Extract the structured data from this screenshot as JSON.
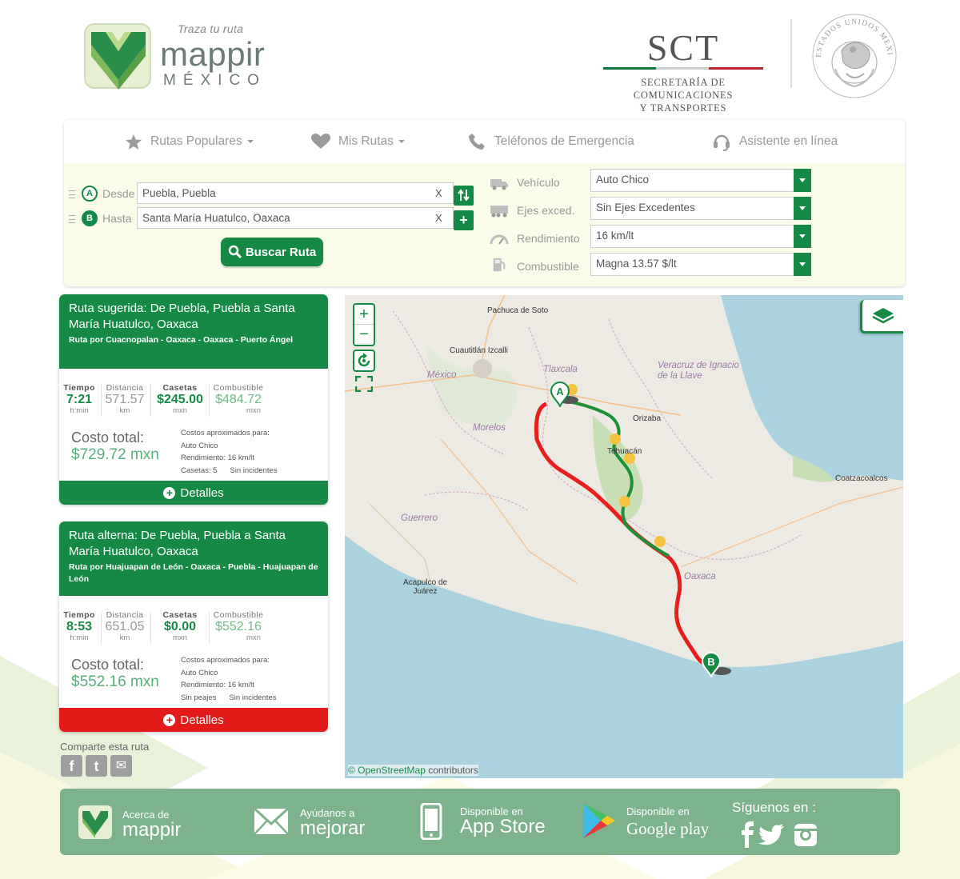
{
  "header": {
    "logo_tag": "Traza tu ruta",
    "logo_word": "mappir",
    "logo_country": "MÉXICO",
    "sct_title": "SCT",
    "sct_line1": "SECRETARÍA DE",
    "sct_line2": "COMUNICACIONES",
    "sct_line3": "Y TRANSPORTES",
    "seal_text": "ESTADOS UNIDOS MEXICANOS"
  },
  "nav": {
    "populares": "Rutas Populares",
    "mis_rutas": "Mis Rutas",
    "telefonos": "Teléfonos de Emergencia",
    "asistente": "Asistente en línea"
  },
  "search": {
    "from_pin": "A",
    "to_pin": "B",
    "from_label": "Desde",
    "to_label": "Hasta",
    "from_value": "Puebla, Puebla",
    "to_value": "Santa María Huatulco, Oaxaca",
    "clear": "X",
    "button": "Buscar Ruta"
  },
  "options": {
    "vehiculo_label": "Vehículo",
    "vehiculo_value": "Auto Chico",
    "ejes_label": "Ejes exced.",
    "ejes_value": "Sin Ejes Excedentes",
    "rendimiento_label": "Rendimiento",
    "rendimiento_value": "16 km/lt",
    "combustible_label": "Combustible",
    "combustible_value": "Magna 13.57 $/lt"
  },
  "labels": {
    "tiempo": "Tiempo",
    "distancia": "Distancia",
    "casetas": "Casetas",
    "combustible": "Combustible",
    "hmin": "h:min",
    "km": "km",
    "mxn": "mxn",
    "costo_total": "Costo total:",
    "costos_para": "Costos aproximados para:",
    "detalles": "Detalles"
  },
  "routes": [
    {
      "title": "Ruta sugerida: De Puebla, Puebla a Santa María Huatulco, Oaxaca",
      "subtitle": "Ruta por Cuacnopalan - Oaxaca - Oaxaca - Puerto Ángel",
      "tiempo": "7:21",
      "distancia": "571.57",
      "casetas": "$245.00",
      "combustible": "$484.72",
      "costo_total": "$729.72 mxn",
      "vehiculo": "Auto Chico",
      "rendimiento": "Rendimiento: 16 km/lt",
      "peajes": "Casetas: 5",
      "incidentes": "Sin incidentes",
      "color": "#168a45"
    },
    {
      "title": "Ruta alterna: De Puebla, Puebla a Santa María Huatulco, Oaxaca",
      "subtitle": "Ruta por Huajuapan de León - Oaxaca - Puebla - Huajuapan de León",
      "tiempo": "8:53",
      "distancia": "651.05",
      "casetas": "$0.00",
      "combustible": "$552.16",
      "costo_total": "$552.16 mxn",
      "vehiculo": "Auto Chico",
      "rendimiento": "Rendimiento: 16 km/lt",
      "peajes": "Sin peajes",
      "incidentes": "Sin incidentes",
      "color": "#e21a1a"
    }
  ],
  "share": {
    "label": "Comparte esta ruta",
    "facebook": "f",
    "twitter": "t",
    "email": "✉"
  },
  "map": {
    "places": {
      "pachuca": "Pachuca de Soto",
      "cuautitlan": "Cuautitlán Izcalli",
      "tlaxcala": "Tlaxcala",
      "mexico": "México",
      "veracruz": "Veracruz de Ignacio de la Llave",
      "orizaba": "Orizaba",
      "morelos": "Morelos",
      "tehuacan": "Tehuacán",
      "coatzacoalcos": "Coatzacoalcos",
      "guerrero": "Guerrero",
      "oaxaca": "Oaxaca",
      "acapulco1": "Acapulco de",
      "acapulco2": "Juárez"
    },
    "marker_a": "A",
    "marker_b": "B",
    "toll_badge": "$",
    "zoom_in": "+",
    "zoom_out": "−",
    "attribution_link": "© OpenStreetMap",
    "attribution_rest": "contributors"
  },
  "footer": {
    "acerca_small": "Acerca de",
    "acerca_big": "mappir",
    "ayudanos_small": "Ayúdanos a",
    "ayudanos_big": "mejorar",
    "appstore_small": "Disponible en",
    "appstore_big": "App Store",
    "gplay_small": "Disponible en",
    "gplay_big": "Google play",
    "siguenos": "Síguenos en :"
  }
}
